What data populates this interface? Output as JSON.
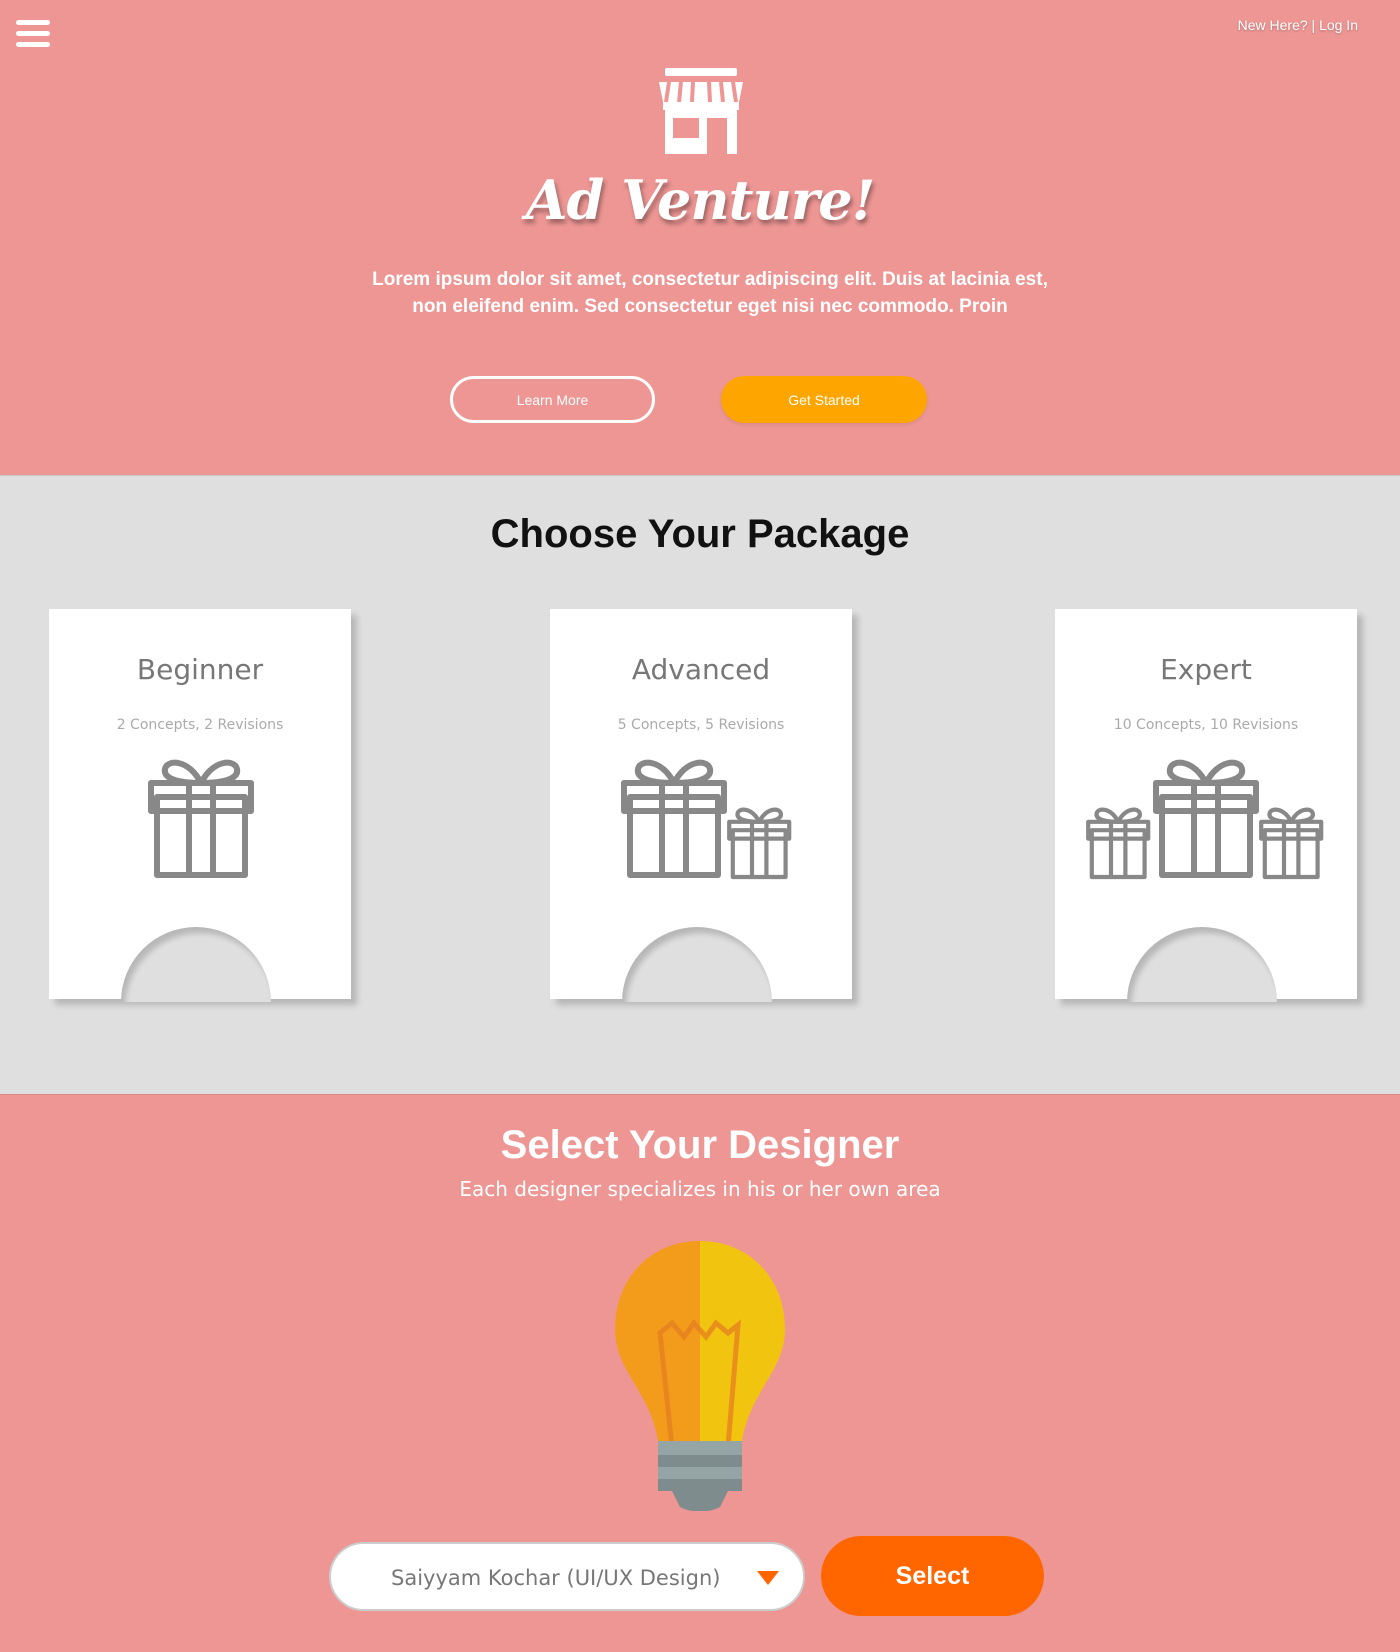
{
  "nav": {
    "menu_icon": "hamburger-icon",
    "top_links": {
      "signup": "New Here?",
      "separator": " | ",
      "login": "Log In"
    }
  },
  "hero": {
    "logo_icon": "storefront-icon",
    "brand": "Ad Venture!",
    "description": "Lorem ipsum dolor sit amet, consectetur adipiscing elit. Duis at lacinia est, non eleifend enim. Sed consectetur eget nisi nec commodo. Proin",
    "learn_more": "Learn More",
    "get_started": "Get Started"
  },
  "packages": {
    "title": "Choose Your Package",
    "items": [
      {
        "name": "Beginner",
        "details": "2 Concepts, 2 Revisions",
        "icon": "single-gift-icon"
      },
      {
        "name": "Advanced",
        "details": "5 Concepts, 5 Revisions",
        "icon": "two-gifts-icon"
      },
      {
        "name": "Expert",
        "details": "10 Concepts, 10 Revisions",
        "icon": "three-gifts-icon"
      }
    ]
  },
  "designer": {
    "title": "Select Your Designer",
    "subtitle": "Each designer specializes in his or her own area",
    "illustration": "lightbulb-icon",
    "selected_designer": "Saiyyam Kochar (UI/UX Design)",
    "select_button": "Select"
  },
  "colors": {
    "background": "#ED9694",
    "panel": "#DFDFDF",
    "accent_orange": "#FFA500",
    "accent_deep_orange": "#FF6600",
    "icon_gray": "#888888"
  }
}
